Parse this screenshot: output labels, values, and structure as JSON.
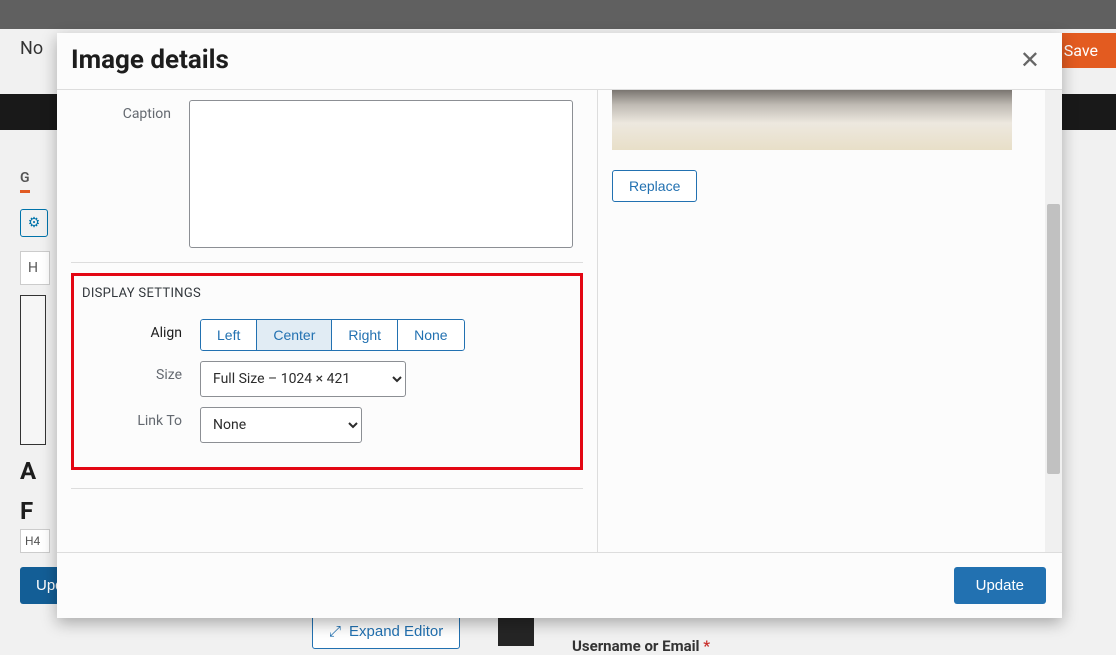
{
  "background": {
    "corner_text": "No",
    "save_btn": "Save",
    "tab": "G",
    "box_h": "H",
    "heading1": "A",
    "heading2": "F",
    "small": "H4",
    "update_preview": "Update Preview",
    "expand_editor": "Expand Editor",
    "form_label": "Username or Email",
    "required": " *"
  },
  "modal": {
    "title": "Image details",
    "close": "✕",
    "caption_label": "Caption",
    "caption_value": "",
    "section_title": "DISPLAY SETTINGS",
    "align_label": "Align",
    "align_options": {
      "left": "Left",
      "center": "Center",
      "right": "Right",
      "none": "None"
    },
    "size_label": "Size",
    "size_value": "Full Size – 1024 × 421",
    "linkto_label": "Link To",
    "linkto_value": "None",
    "replace": "Replace",
    "update": "Update"
  }
}
